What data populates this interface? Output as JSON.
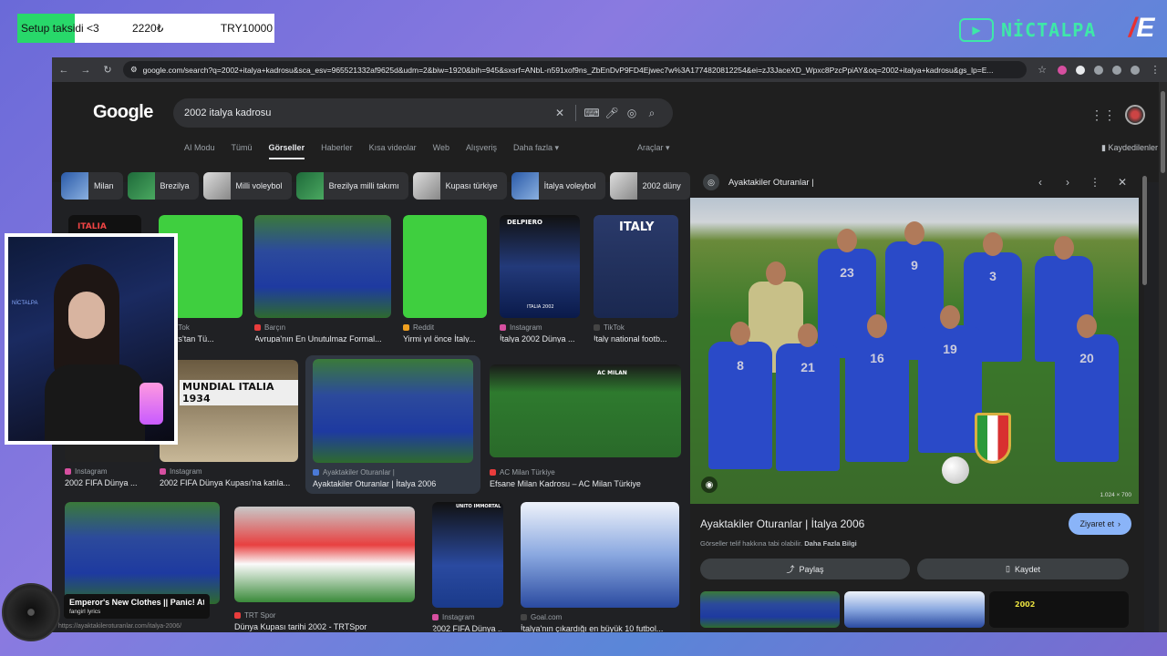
{
  "overlay": {
    "donation_label": "Setup taksidi <3",
    "donation_current": "2220₺",
    "donation_goal": "TRY10000",
    "donation_progress": 0.222,
    "brand_name": "NİCTALPA"
  },
  "browser": {
    "url": "google.com/search?q=2002+italya+kadrosu&sca_esv=965521332af9625d&udm=2&biw=1920&bih=945&sxsrf=ANbL-n591xof9ns_ZbEnDvP9FD4Ejwec7w%3A1774820812254&ei=zJ3JaceXD_Wpxc8PzcPpiAY&oq=2002+italya+kadrosu&gs_lp=E..."
  },
  "google": {
    "logo": "Google",
    "query": "2002 italya kadrosu",
    "tabs": [
      "AI Modu",
      "Tümü",
      "Görseller",
      "Haberler",
      "Kısa videolar",
      "Web",
      "Alışveriş",
      "Daha fazla ▾"
    ],
    "active_tab": "Görseller",
    "tools": "Araçlar ▾",
    "saved": "Kaydedilenler",
    "chips": [
      "Milan",
      "Brezilya",
      "Milli voleybol",
      "Brezilya milli takımı",
      "Kupası türkiye",
      "İtalya voleybol",
      "2002 düny"
    ]
  },
  "results": [
    {
      "source": "TikTok",
      "caption": "Sports'tan Tü..."
    },
    {
      "source": "Barçın",
      "caption": "Avrupa'nın En Unutulmaz Formal..."
    },
    {
      "source": "Reddit",
      "caption": "Yirmi yıl önce İtaly..."
    },
    {
      "source": "Instagram",
      "caption": "İtalya 2002 Dünya ..."
    },
    {
      "source": "TikTok",
      "caption": "Italy national footb..."
    },
    {
      "source": "Instagram",
      "caption": "2002 FIFA Dünya ..."
    },
    {
      "source": "Instagram",
      "caption": "2002 FIFA Dünya Kupası'na katıla..."
    },
    {
      "source": "Ayaktakiler Oturanlar |",
      "caption": "Ayaktakiler Oturanlar | İtalya 2006"
    },
    {
      "source": "AC Milan Türkiye",
      "caption": "Efsane Milan Kadrosu – AC Milan Türkiye"
    },
    {
      "source": "TRT Spor",
      "caption": "Dünya Kupası tarihi 2002 - TRTSpor"
    },
    {
      "source": "Instagram",
      "caption": "2002 FIFA Dünya ..."
    },
    {
      "source": "Goal.com",
      "caption": "İtalya'nın çıkardığı en büyük 10 futbol..."
    }
  ],
  "thumb_text": {
    "italia_top": "ITALIA",
    "italy_poster": "ITALY",
    "delpiero": "DELPIERO",
    "italy2002": "ITALIA 2002",
    "mundial": "MUNDIAL ITALIA 1934",
    "acmilan": "AC MILAN",
    "unito": "UNITO IMMORTAL",
    "badge2002": "2002"
  },
  "preview": {
    "site": "Ayaktakiler Oturanlar |",
    "title": "Ayaktakiler Oturanlar | İtalya 2006",
    "dims": "1.024 × 700",
    "visit": "Ziyaret et",
    "notice": "Görseller telif hakkına tabi olabilir.",
    "notice_more": "Daha Fazla Bilgi",
    "share": "Paylaş",
    "save": "Kaydet",
    "related_badge": "2002",
    "jersey_numbers": [
      "23",
      "9",
      "3",
      "8",
      "21",
      "16",
      "19",
      "20"
    ]
  },
  "webcam": {
    "neon": "NİCTALPA"
  },
  "music": {
    "song": "Emperor's New Clothes || Panic! At ...",
    "artist": "fangirl lyrics",
    "under_url": "https://ayaktakileroturanlar.com/italya-2006/"
  },
  "colors": {
    "accent": "#8ab4f8",
    "brand": "#3ee8a8",
    "donation": "#28d86a"
  }
}
